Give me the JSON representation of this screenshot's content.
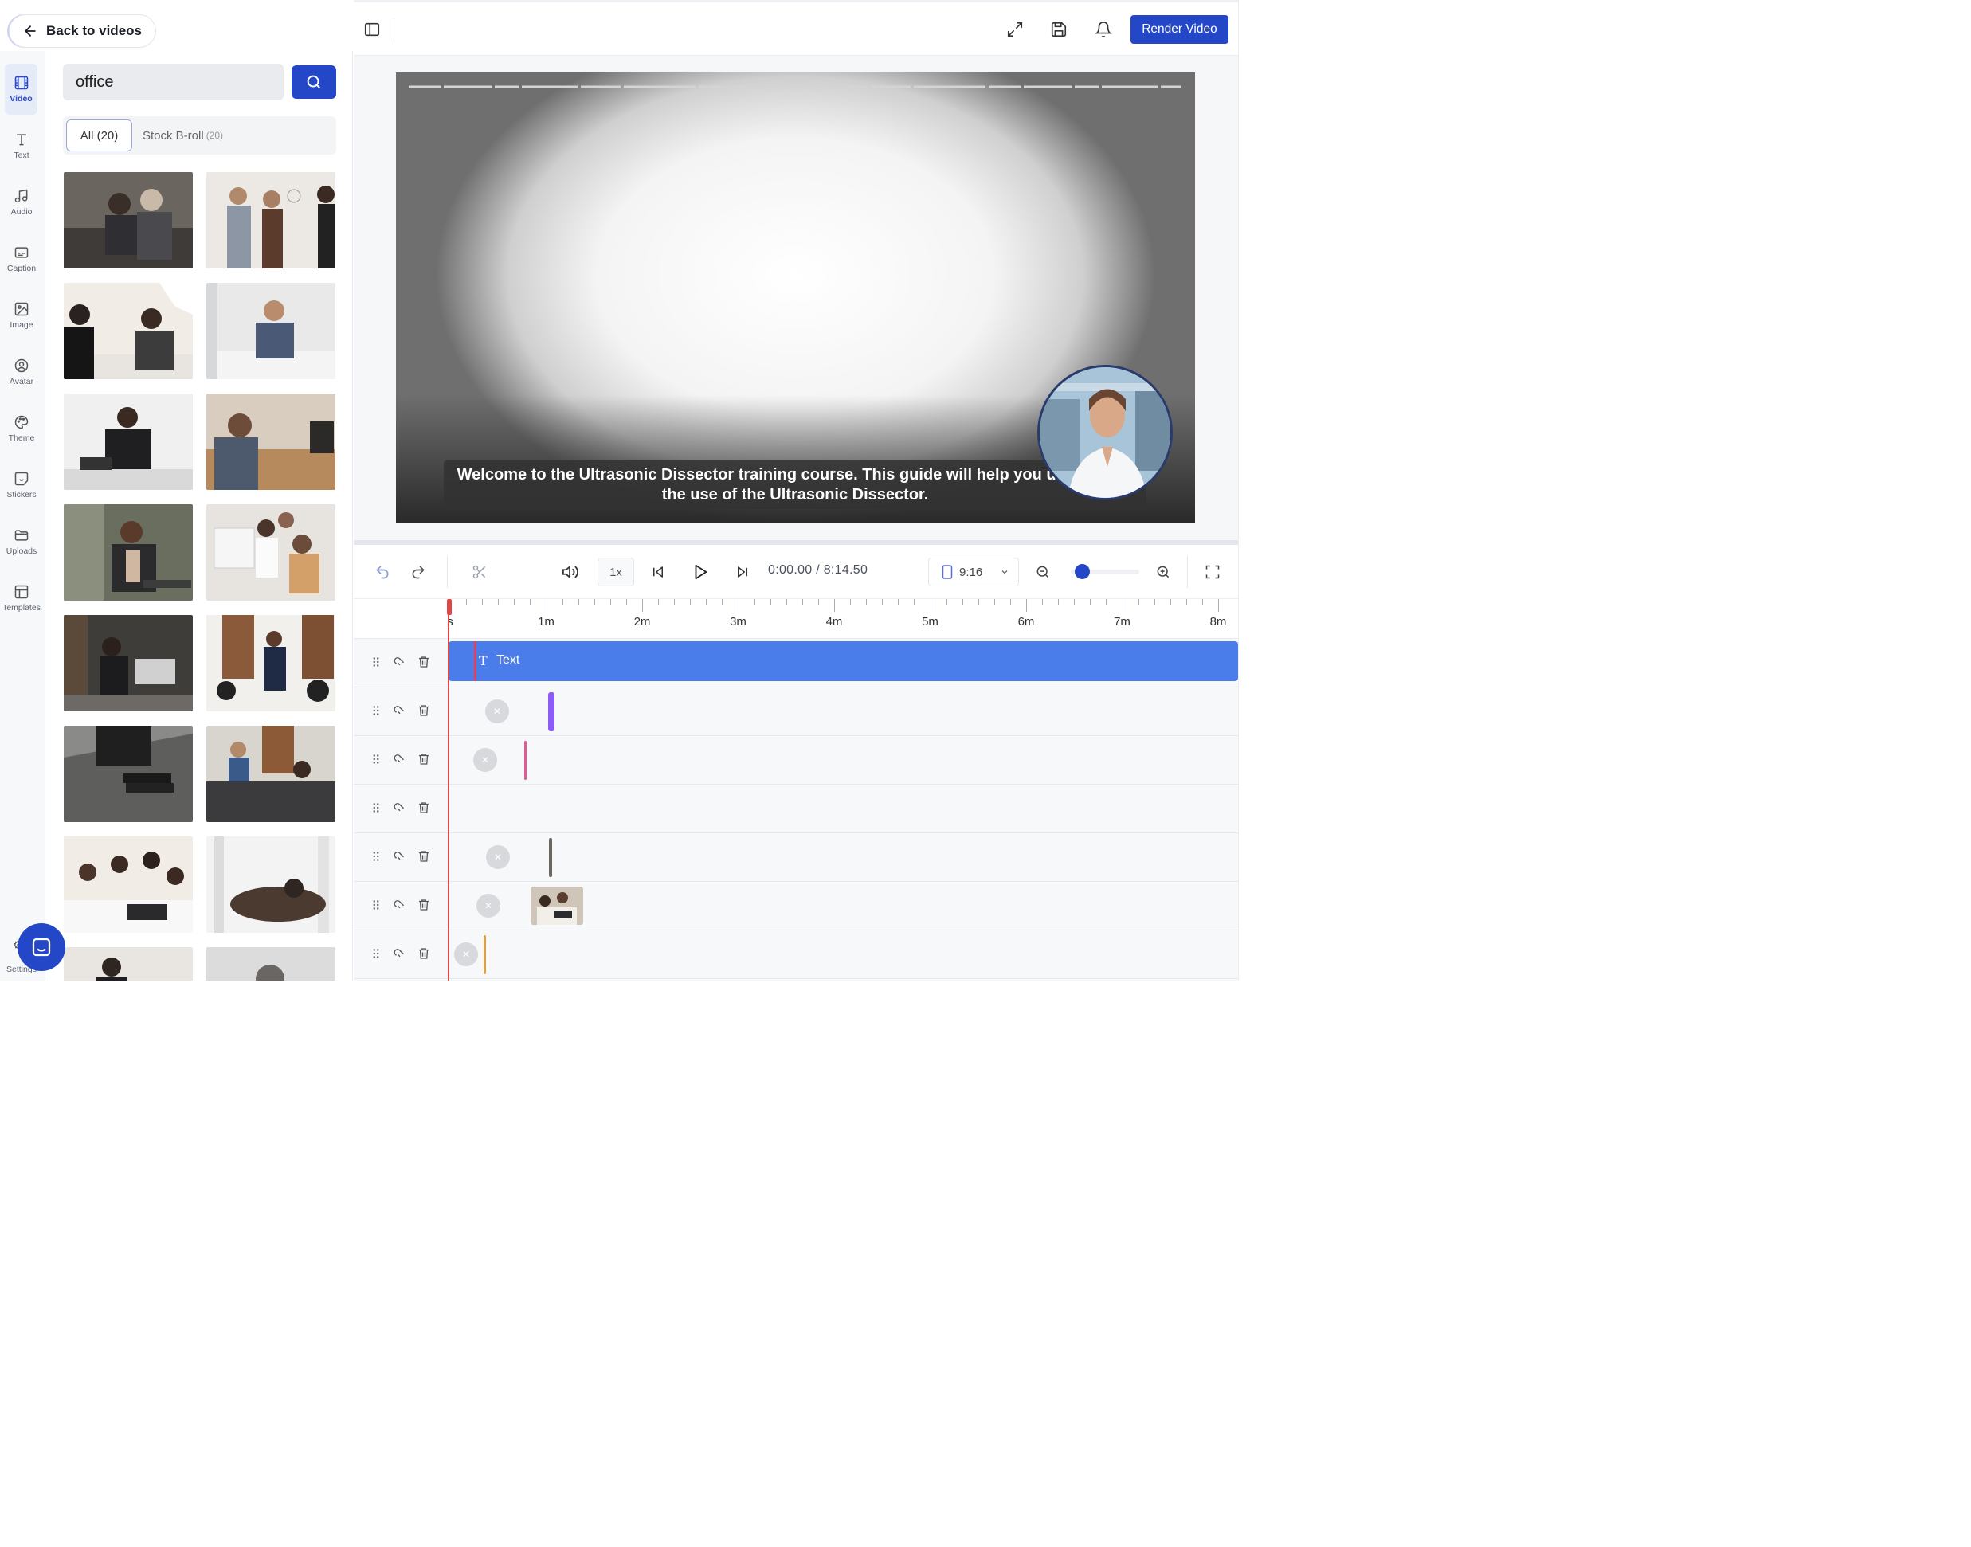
{
  "back_button": {
    "label": "Back to videos"
  },
  "sidebar": {
    "items": [
      {
        "label": "Video",
        "icon": "film-icon",
        "active": true
      },
      {
        "label": "Text",
        "icon": "text-icon"
      },
      {
        "label": "Audio",
        "icon": "music-icon"
      },
      {
        "label": "Caption",
        "icon": "caption-icon"
      },
      {
        "label": "Image",
        "icon": "image-icon"
      },
      {
        "label": "Avatar",
        "icon": "avatar-icon"
      },
      {
        "label": "Theme",
        "icon": "palette-icon"
      },
      {
        "label": "Stickers",
        "icon": "sticker-icon"
      },
      {
        "label": "Uploads",
        "icon": "folder-icon"
      },
      {
        "label": "Templates",
        "icon": "layout-icon"
      }
    ],
    "settings_label": "Settings"
  },
  "search": {
    "value": "office",
    "placeholder": ""
  },
  "filters": {
    "all_label": "All (20)",
    "stock_label": "Stock B-roll",
    "stock_count": "(20)"
  },
  "toolbar": {
    "render_label": "Render Video"
  },
  "preview": {
    "caption": "Welcome to the Ultrasonic Dissector training course. This guide will help you understand the use of the Ultrasonic Dissector."
  },
  "controls": {
    "speed": "1x",
    "time": "0:00.00 / 8:14.50",
    "aspect_ratio": "9:16",
    "zoom_level": 0.1
  },
  "timeline": {
    "ruler_labels": [
      "s",
      "1m",
      "2m",
      "3m",
      "4m",
      "5m",
      "6m",
      "7m",
      "8m"
    ],
    "text_clip_label": "Text"
  },
  "colors": {
    "accent": "#2447c8",
    "text_clip": "#4a7cea",
    "playhead": "#e04646"
  }
}
